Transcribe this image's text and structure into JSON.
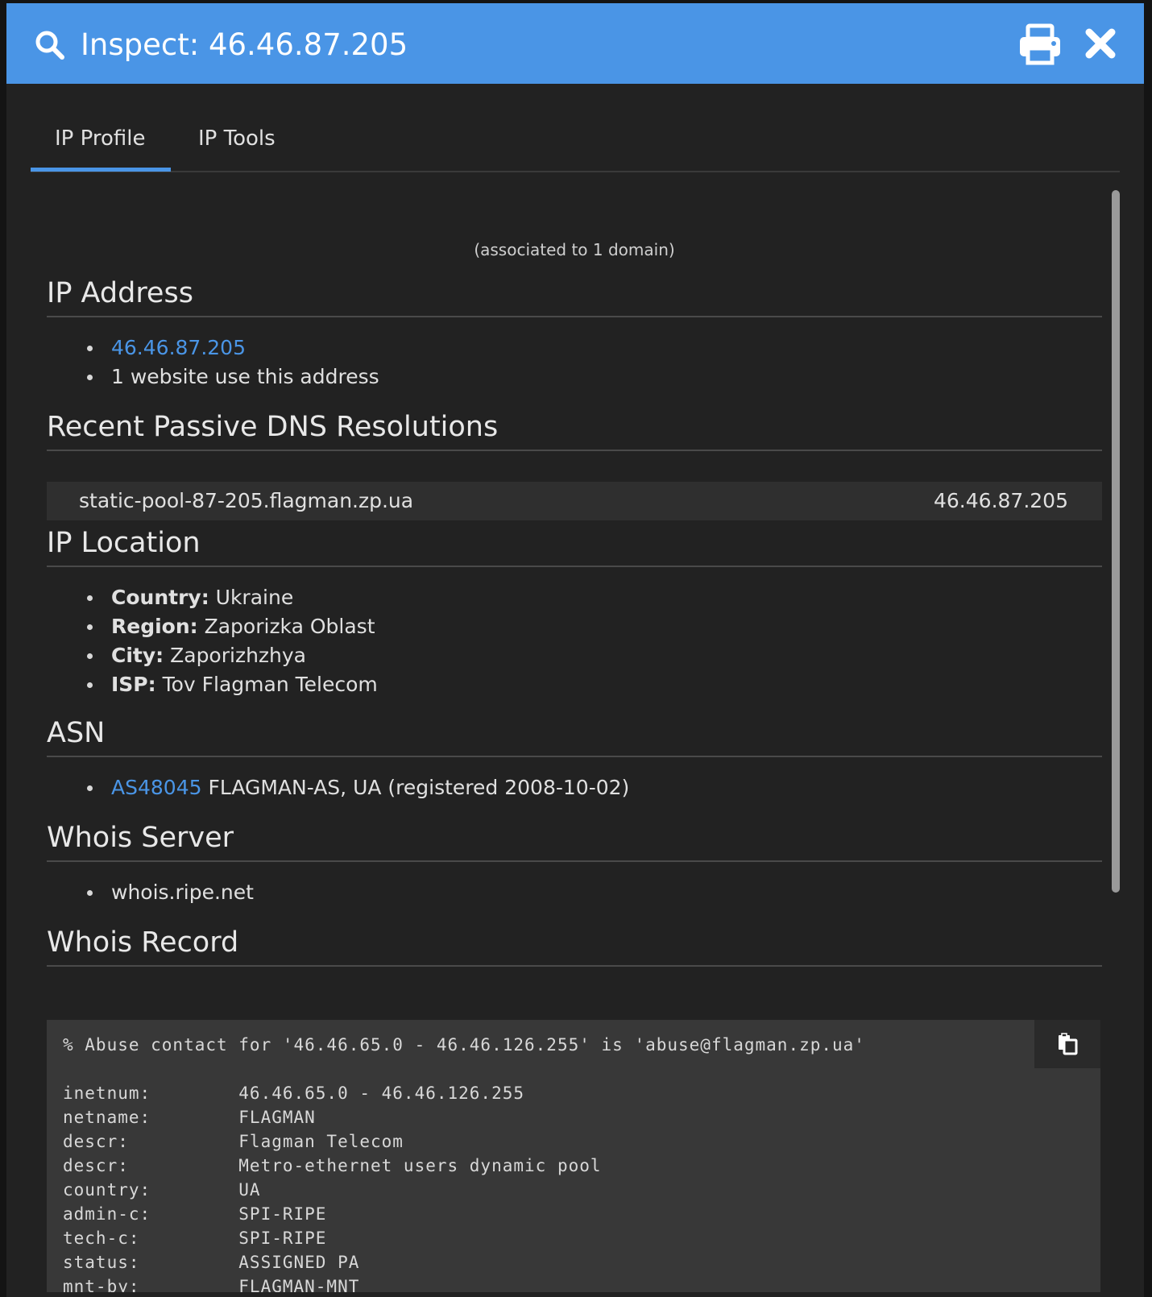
{
  "header": {
    "title": "Inspect: 46.46.87.205"
  },
  "tabs": [
    {
      "label": "IP Profile",
      "active": true
    },
    {
      "label": "IP Tools",
      "active": false
    }
  ],
  "profile": {
    "associated_text": "(associated to 1 domain)",
    "ip_address": {
      "title": "IP Address",
      "ip": "46.46.87.205",
      "websites": "1 website use this address"
    },
    "dns": {
      "title": "Recent Passive DNS Resolutions",
      "rows": [
        {
          "host": "static-pool-87-205.flagman.zp.ua",
          "ip": "46.46.87.205"
        }
      ]
    },
    "location": {
      "title": "IP Location",
      "items": [
        {
          "label": "Country:",
          "value": " Ukraine"
        },
        {
          "label": "Region:",
          "value": " Zaporizka Oblast"
        },
        {
          "label": "City:",
          "value": " Zaporizhzhya"
        },
        {
          "label": "ISP:",
          "value": " Tov Flagman Telecom"
        }
      ]
    },
    "asn": {
      "title": "ASN",
      "number": "AS48045",
      "description": " FLAGMAN-AS, UA (registered 2008-10-02)"
    },
    "whois_server": {
      "title": "Whois Server",
      "server": "whois.ripe.net"
    },
    "whois_record": {
      "title": "Whois Record",
      "text": "% Abuse contact for '46.46.65.0 - 46.46.126.255' is 'abuse@flagman.zp.ua'\n\ninetnum:        46.46.65.0 - 46.46.126.255\nnetname:        FLAGMAN\ndescr:          Flagman Telecom\ndescr:          Metro-ethernet users dynamic pool\ncountry:        UA\nadmin-c:        SPI-RIPE\ntech-c:         SPI-RIPE\nstatus:         ASSIGNED PA\nmnt-by:         FLAGMAN-MNT"
    }
  },
  "colors": {
    "header_bg": "#4a95e6",
    "link": "#4a95e6",
    "panel_bg": "#222222",
    "code_bg": "#383838"
  },
  "icons": {
    "search": "search-icon",
    "print": "print-icon",
    "close": "close-icon",
    "copy": "copy-icon"
  }
}
